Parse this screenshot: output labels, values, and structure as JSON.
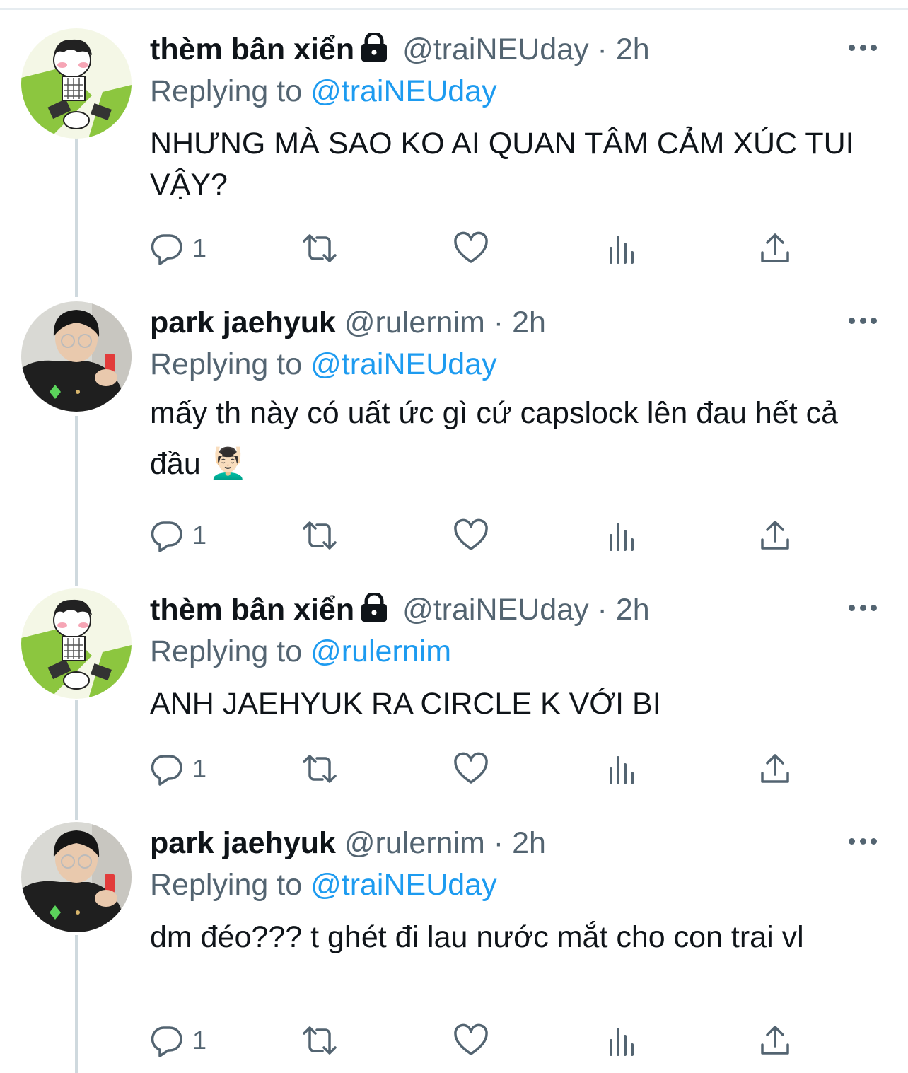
{
  "tweets": [
    {
      "avatar": "cartoon-avatar",
      "name": "thèm bân xiển",
      "locked": true,
      "handle": "@traiNEUday",
      "dot": "·",
      "time": "2h",
      "replying_label": "Replying to",
      "replying_to": "@traiNEUday",
      "body": "NHƯNG MÀ SAO KO AI QUAN TÂM CẢM XÚC TUI VẬY?",
      "reply_count": "1"
    },
    {
      "avatar": "photo-avatar",
      "name": "park jaehyuk",
      "locked": false,
      "handle": "@rulernim",
      "dot": "·",
      "time": "2h",
      "replying_label": "Replying to",
      "replying_to": "@traiNEUday",
      "body": "mấy th này có uất ức gì cứ capslock lên đau hết cả đầu 💆🏻‍♂️",
      "reply_count": "1"
    },
    {
      "avatar": "cartoon-avatar",
      "name": "thèm bân xiển",
      "locked": true,
      "handle": "@traiNEUday",
      "dot": "·",
      "time": "2h",
      "replying_label": "Replying to",
      "replying_to": "@rulernim",
      "body": "ANH JAEHYUK RA CIRCLE K VỚI BI",
      "reply_count": "1"
    },
    {
      "avatar": "photo-avatar",
      "name": "park jaehyuk",
      "locked": false,
      "handle": "@rulernim",
      "dot": "·",
      "time": "2h",
      "replying_label": "Replying to",
      "replying_to": "@traiNEUday",
      "body": "dm đéo??? t ghét đi lau nước mắt cho con trai vl",
      "reply_count": "1"
    }
  ],
  "icons": {
    "reply": "reply-icon",
    "retweet": "retweet-icon",
    "like": "like-icon",
    "views": "views-icon",
    "share": "share-icon",
    "more": "more-icon",
    "lock": "lock-icon"
  },
  "colors": {
    "text": "#0f1419",
    "secondary": "#536471",
    "link": "#1d9bf0",
    "thread_line": "#cfd9de"
  }
}
